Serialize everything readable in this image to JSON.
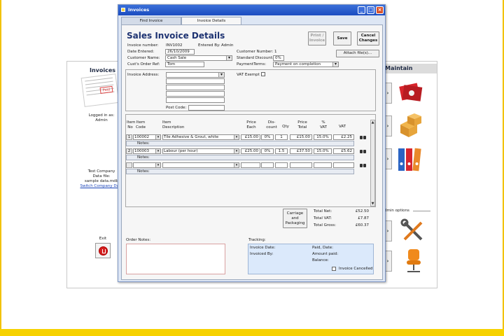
{
  "window": {
    "title": "Invoices"
  },
  "tabs": [
    {
      "label": "Find Invoice"
    },
    {
      "label": "Invoice Details"
    }
  ],
  "page_title": "Sales Invoice Details",
  "header": {
    "invoice_number_label": "Invoice number:",
    "invoice_number": "INV1002",
    "entered_by_label": "Entered By:",
    "entered_by": "Admin",
    "date_entered_label": "Date Entered:",
    "date_entered": "26/10/2009",
    "customer_number_label": "Customer Number:",
    "customer_number": "1",
    "customer_name_label": "Customer Name:",
    "customer_name": "Cash Sale",
    "standard_discount_label": "Standard Discount:",
    "standard_discount": "0%",
    "cust_order_ref_label": "Cust's Order Ref:",
    "cust_order_ref": "Tom",
    "payment_terms_label": "PaymentTerms:",
    "payment_terms": "Payment on completion"
  },
  "buttons": {
    "print_invoice": "Print / Invoice",
    "save": "Save",
    "cancel_changes": "Cancel Changes",
    "attach_files": "Attach file(s)...",
    "carriage_packaging": "Carriage and Packaging"
  },
  "address": {
    "label": "Invoice Address:",
    "post_code_label": "Post Code:",
    "vat_exempt_label": "VAT Exempt"
  },
  "columns": {
    "item_no": "Item No",
    "item_code": "Item Code",
    "item_desc": "Item Description",
    "price_each": "Price Each",
    "discount": "Dis-count",
    "qty": "Qty",
    "price_total": "Price Total",
    "vat_pct": "% VAT",
    "vat": "VAT"
  },
  "line_items": [
    {
      "no": "1",
      "code": "100002",
      "description": "Tile Adhesive & Grout, white",
      "price_each": "£15.00",
      "discount": "0%",
      "qty": "1",
      "total": "£15.00",
      "vat_pct": "15.0%",
      "vat": "£2.25",
      "notes_label": "Notes:"
    },
    {
      "no": "2",
      "code": "100003",
      "description": "Labour (per hour)",
      "price_each": "£25.00",
      "discount": "0%",
      "qty": "1.5",
      "total": "£37.50",
      "vat_pct": "15.0%",
      "vat": "£5.62",
      "notes_label": "Notes:"
    }
  ],
  "new_row": {
    "notes_label": "Notes:"
  },
  "totals": {
    "net_label": "Total Net:",
    "net": "£52.50",
    "vat_label": "Total VAT:",
    "vat": "£7.87",
    "gross_label": "Total Gross:",
    "gross": "£60.37"
  },
  "order_notes_label": "Order Notes:",
  "tracking": {
    "label": "Tracking:",
    "invoice_date_label": "Invoice Date:",
    "paid_date_label": "Paid, Date:",
    "invoiced_by_label": "Invoiced By:",
    "amount_paid_label": "Amount paid:",
    "balance_label": "Balance:",
    "invoice_cancelled_label": "Invoice Cancelled"
  },
  "background": {
    "left_title": "Invoices",
    "logged_in_label": "Logged in as:",
    "logged_in_user": "Admin",
    "company": "Test Company",
    "data_file_label": "Data file:",
    "data_file": "sample data.mdb",
    "switch_company": "Switch Company Data",
    "exit_label": "Exit",
    "right_title": "Maintain",
    "admin_options": "dmin options",
    "paid_stamp": "Paid"
  }
}
